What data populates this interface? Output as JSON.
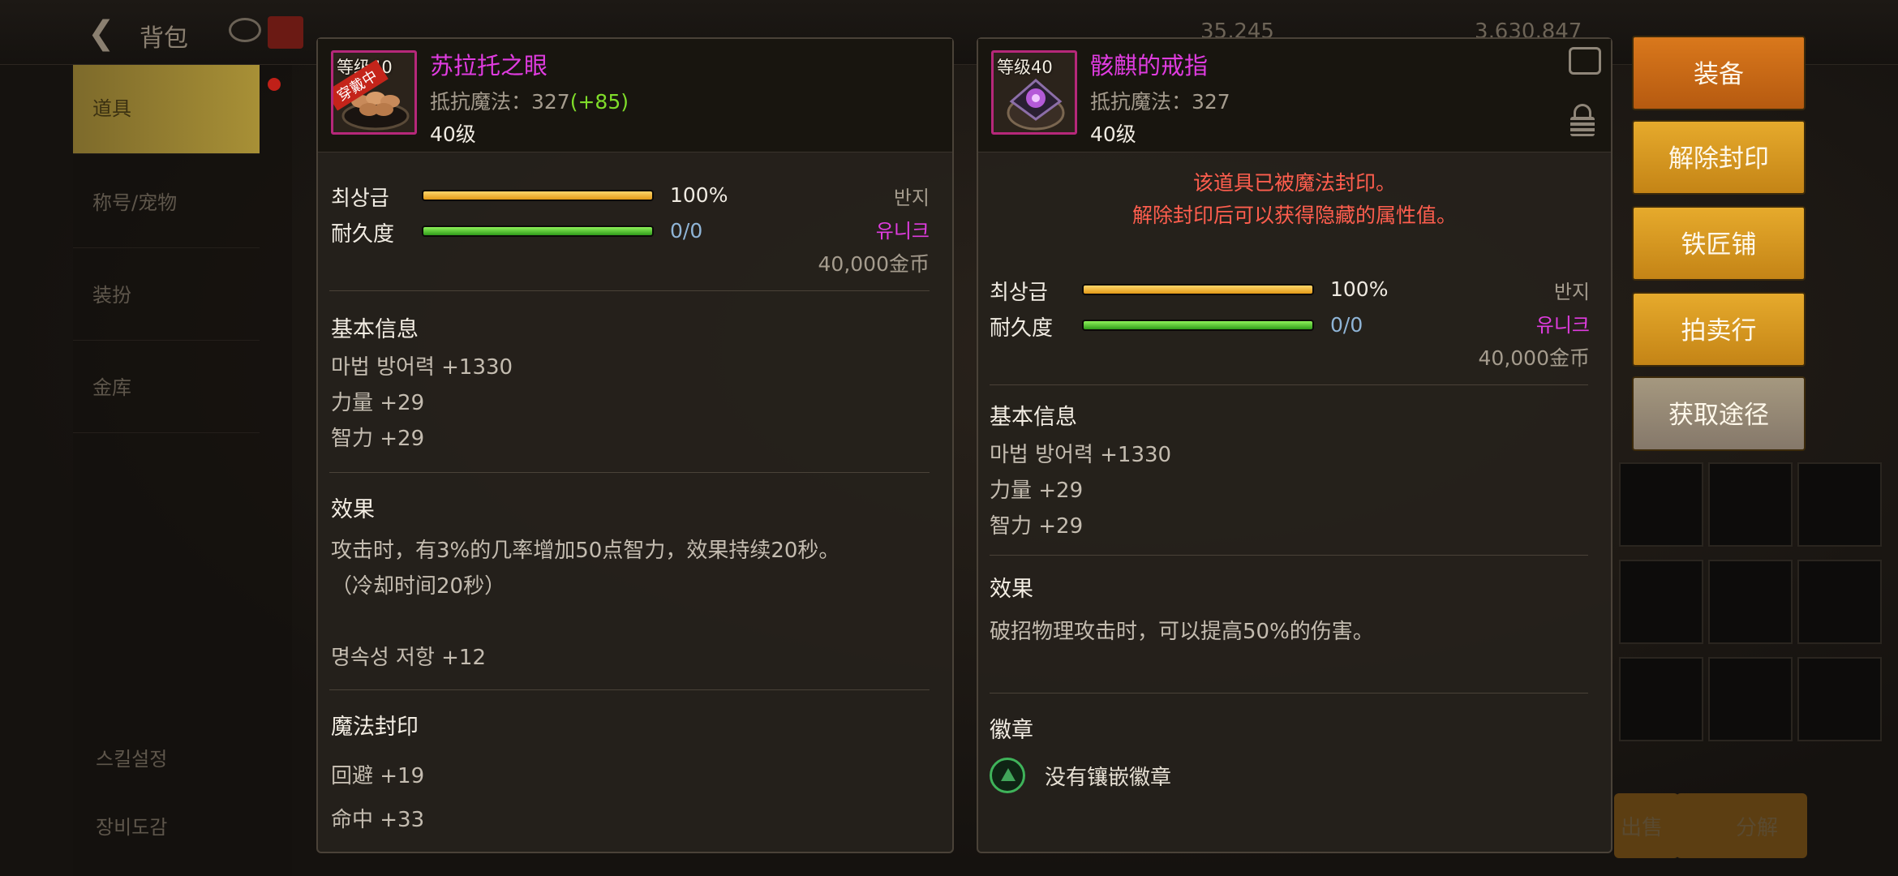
{
  "background": {
    "title": "背包",
    "side_tabs": [
      "道具",
      "称号/宠物",
      "装扮",
      "金库"
    ],
    "side_bottom": [
      "스킬설정",
      "장비도감"
    ],
    "gold_1": "35,245",
    "gold_2": "3,630,847"
  },
  "left_item": {
    "name": "苏拉托之眼",
    "level_tag": "等级40",
    "equipped_badge": "穿戴中",
    "stat_label": "抵抗魔法：327",
    "stat_bonus": "(+85)",
    "req_level": "40级",
    "grade_label": "최상급",
    "grade_value": "100%",
    "grade_fill": 1.0,
    "durability_label": "耐久度",
    "durability_value": "0/0",
    "durability_fill": 1.0,
    "type": "반지",
    "rarity": "유니크",
    "price": "40,000金币",
    "basic_title": "基本信息",
    "basic_lines": [
      "마법 방어력 +1330",
      "力量 +29",
      "智力 +29"
    ],
    "effect_title": "效果",
    "effect_lines": [
      "攻击时，有3%的几率增加50点智力，效果持续20秒。",
      "（冷却时间20秒）"
    ],
    "extra_line": "명속성 저항 +12",
    "seal_title": "魔法封印",
    "seal_lines": [
      "回避 +19",
      "命中 +33"
    ]
  },
  "right_item": {
    "name": "骸麒的戒指",
    "level_tag": "等级40",
    "stat_label": "抵抗魔法：327",
    "req_level": "40级",
    "seal_notice": [
      "该道具已被魔法封印。",
      "解除封印后可以获得隐藏的属性值。"
    ],
    "grade_label": "최상급",
    "grade_value": "100%",
    "grade_fill": 1.0,
    "durability_label": "耐久度",
    "durability_value": "0/0",
    "durability_fill": 1.0,
    "type": "반지",
    "rarity": "유니크",
    "price": "40,000金币",
    "basic_title": "基本信息",
    "basic_lines": [
      "마법 방어력 +1330",
      "力量 +29",
      "智力 +29"
    ],
    "effect_title": "效果",
    "effect_line": "破招物理攻击时，可以提高50%的伤害。",
    "emblem_title": "徽章",
    "emblem_text": "没有镶嵌徽章"
  },
  "actions": [
    "装备",
    "解除封印",
    "铁匠铺",
    "拍卖行",
    "获取途径"
  ],
  "bottom_buttons": [
    "出售",
    "分解"
  ],
  "colors": {
    "rarity_unique": "#e03ce0",
    "bonus_green": "#7fdc2a",
    "seal_warning": "#ff5e4e"
  }
}
